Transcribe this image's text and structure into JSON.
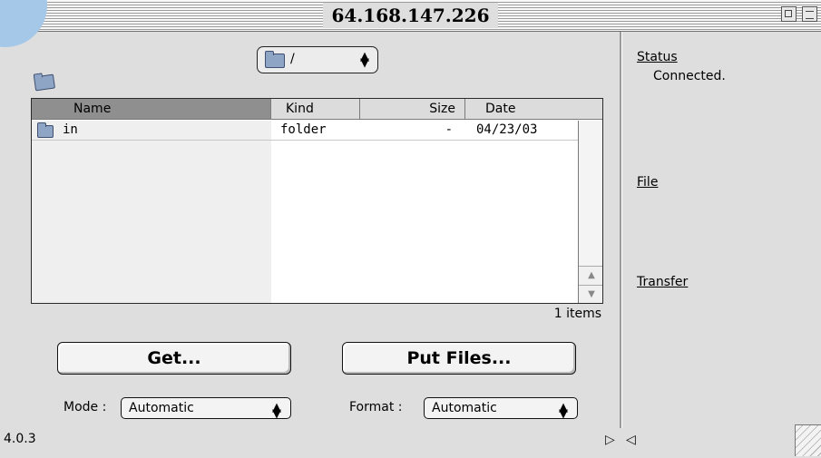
{
  "window": {
    "title": "64.168.147.226"
  },
  "browser": {
    "path": "/",
    "columns": {
      "name": "Name",
      "kind": "Kind",
      "size": "Size",
      "date": "Date"
    },
    "rows": [
      {
        "name": "in",
        "kind": "folder",
        "size": "-",
        "date": "04/23/03",
        "icon": "folder-icon"
      }
    ],
    "item_count": "1 items"
  },
  "actions": {
    "get_label": "Get...",
    "put_label": "Put Files..."
  },
  "options": {
    "mode_label": "Mode :",
    "mode_value": "Automatic",
    "format_label": "Format :",
    "format_value": "Automatic"
  },
  "footer": {
    "version": "4.0.3"
  },
  "panel": {
    "status_heading": "Status",
    "status_value": "Connected.",
    "file_heading": "File",
    "transfer_heading": "Transfer"
  },
  "colors": {
    "folder": "#8fa5c6",
    "sorted_header": "#8f8f8f",
    "window_bg": "#dedede"
  }
}
